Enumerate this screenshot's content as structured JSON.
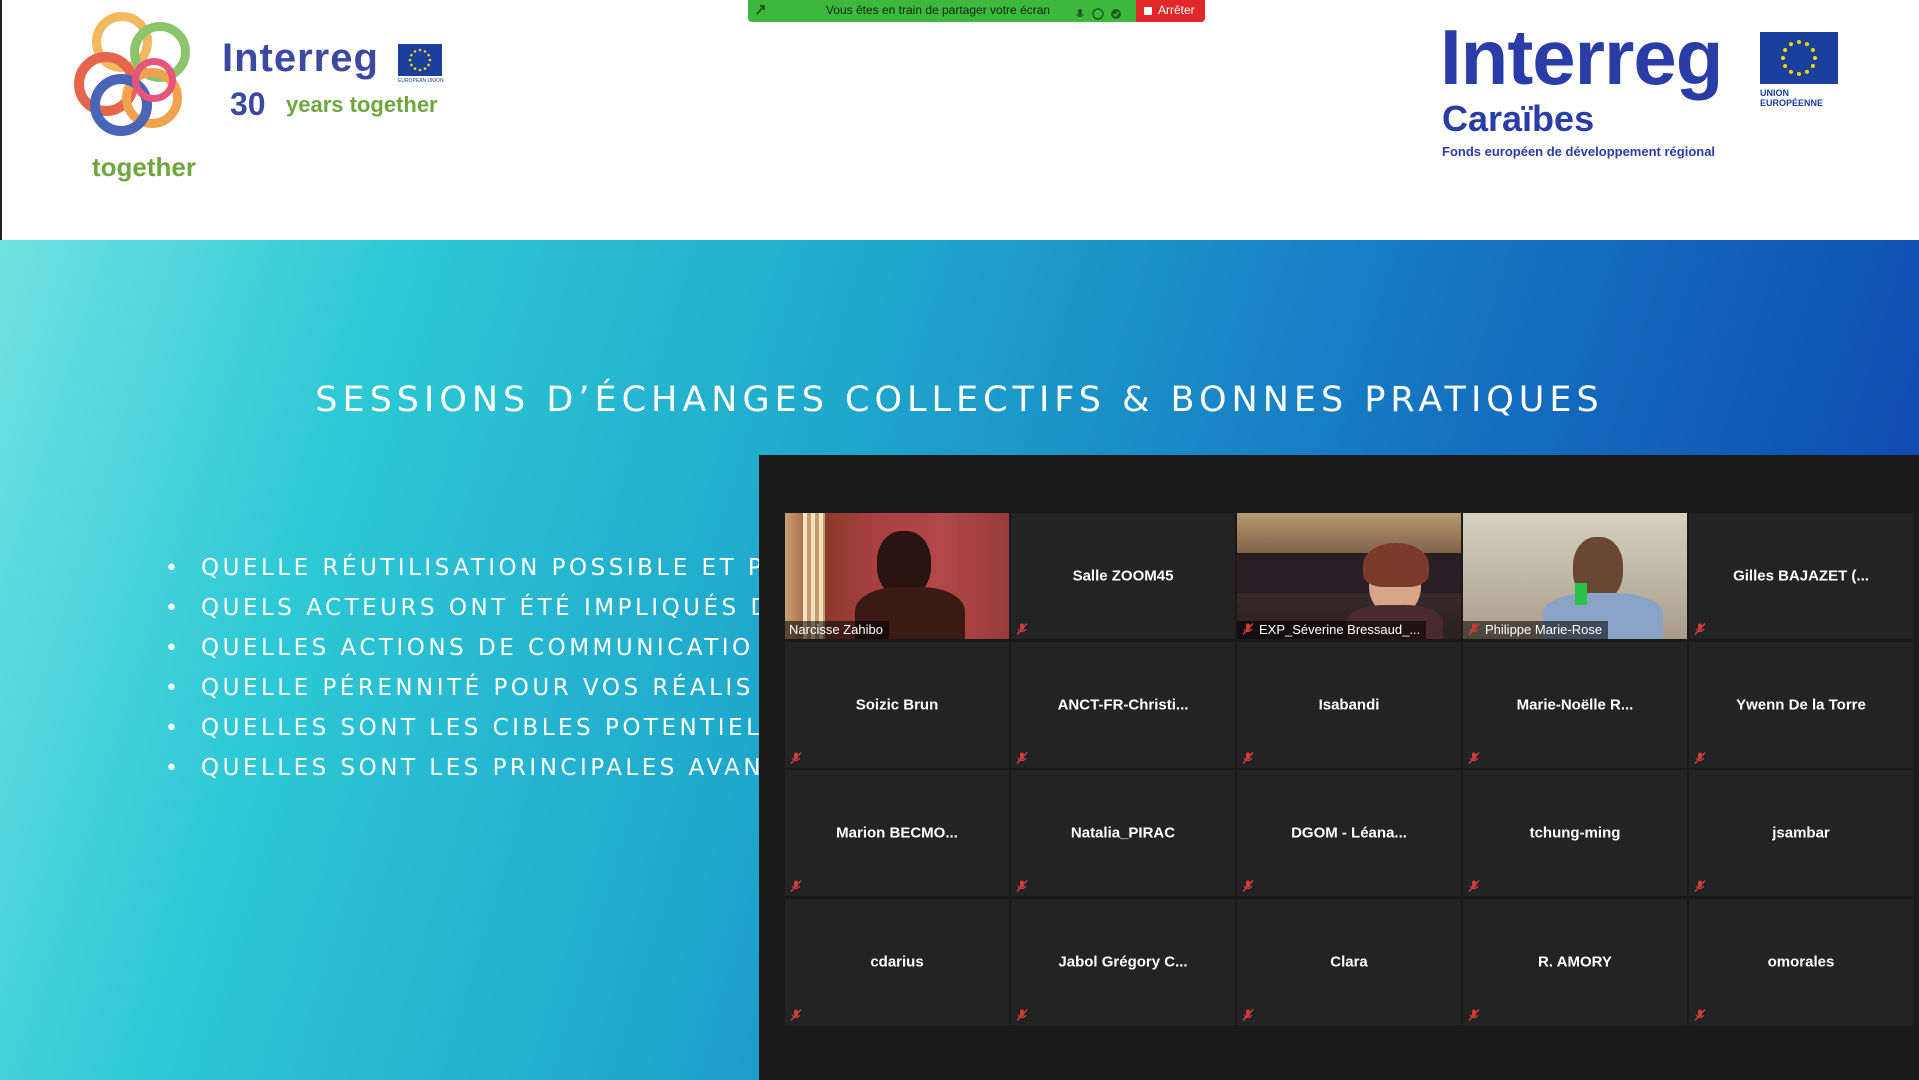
{
  "share_banner": {
    "message": "Vous êtes en train de partager votre écran",
    "stop_label": "Arrêter"
  },
  "slide": {
    "left_logo": {
      "brand": "Interreg",
      "years_number": "30",
      "years_text": "years together",
      "together": "together",
      "eu_caption": "EUROPEAN UNION"
    },
    "right_logo": {
      "brand": "Interreg",
      "region": "Caraïbes",
      "fund": "Fonds européen de développement régional",
      "eu_caption_line1": "UNION",
      "eu_caption_line2": "EUROPÉENNE"
    },
    "title": "SESSIONS D’ÉCHANGES COLLECTIFS & BONNES PRATIQUES",
    "bullets": [
      "QUELLE RÉUTILISATION POSSIBLE ET PA",
      "QUELS ACTEURS ONT ÉTÉ IMPLIQUÉS D",
      "QUELLES ACTIONS DE COMMUNICATIO",
      "QUELLE PÉRENNITÉ POUR VOS RÉALIS",
      "QUELLES SONT LES CIBLES POTENTIEL",
      "QUELLES SONT LES PRINCIPALES AVAN"
    ],
    "colors": {
      "brand_blue": "#2a3ca6",
      "green": "#6fa63d"
    }
  },
  "gallery": {
    "participants": [
      {
        "name": "Narcisse Zahibo",
        "video": true,
        "active": true
      },
      {
        "name": "Salle ZOOM45",
        "video": false
      },
      {
        "name": "EXP_Séverine Bressaud_...",
        "video": true
      },
      {
        "name": "Philippe Marie-Rose",
        "video": true
      },
      {
        "name": "Gilles BAJAZET (...",
        "video": false
      },
      {
        "name": "Soizic Brun",
        "video": false
      },
      {
        "name": "ANCT-FR-Christi...",
        "video": false
      },
      {
        "name": "Isabandi",
        "video": false
      },
      {
        "name": "Marie-Noëlle  R...",
        "video": false
      },
      {
        "name": "Ywenn De la Torre",
        "video": false
      },
      {
        "name": "Marion  BECMO...",
        "video": false
      },
      {
        "name": "Natalia_PIRAC",
        "video": false
      },
      {
        "name": "DGOM  -  Léana...",
        "video": false
      },
      {
        "name": "tchung-ming",
        "video": false
      },
      {
        "name": "jsambar",
        "video": false
      },
      {
        "name": "cdarius",
        "video": false
      },
      {
        "name": "Jabol  Grégory  C...",
        "video": false
      },
      {
        "name": "Clara",
        "video": false
      },
      {
        "name": "R. AMORY",
        "video": false
      },
      {
        "name": "omorales",
        "video": false
      }
    ],
    "mute_icon": "microphone-muted-icon",
    "active_color": "#e8e23c"
  }
}
